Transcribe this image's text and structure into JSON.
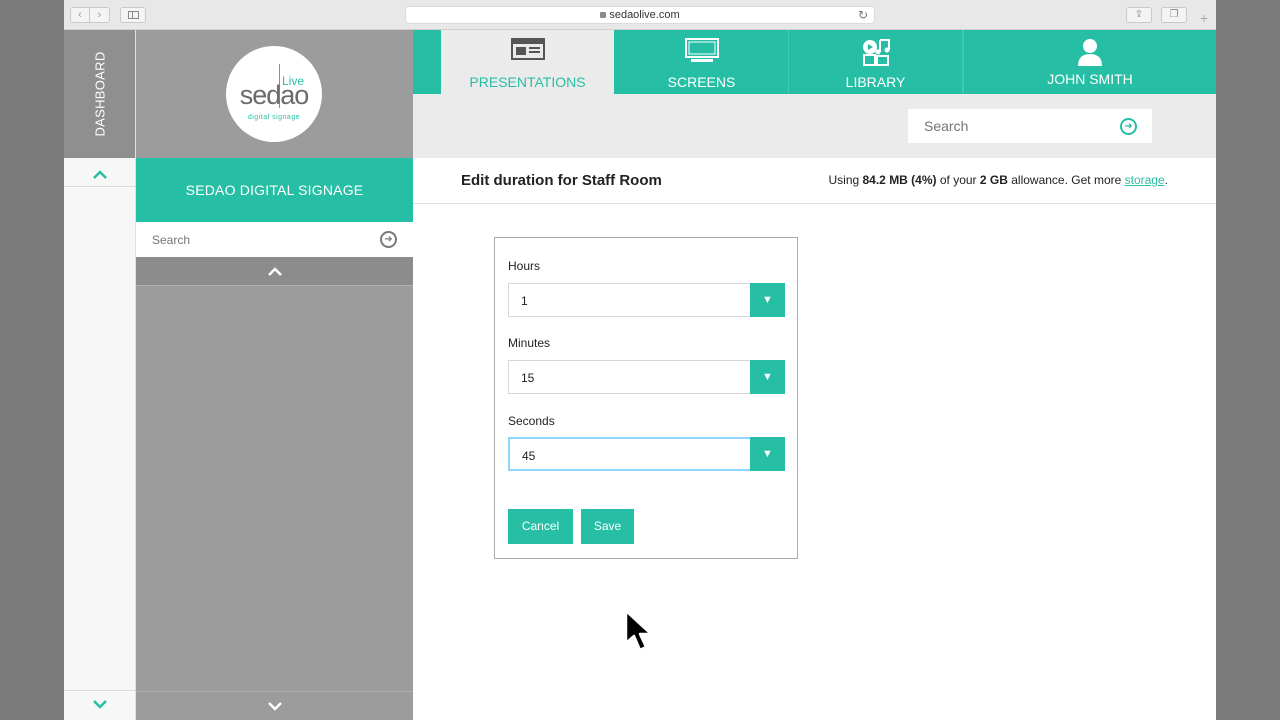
{
  "browser": {
    "url": "sedaolive.com",
    "back_icon": "chevron-left-icon",
    "forward_icon": "chevron-right-icon"
  },
  "rail": {
    "label": "DASHBOARD",
    "up_icon": "^",
    "down_icon": "v"
  },
  "sidebar": {
    "logo": {
      "brand": "sedao",
      "live": "Live",
      "tagline": "digital signage"
    },
    "org_name": "SEDAO DIGITAL SIGNAGE",
    "search_placeholder": "Search"
  },
  "nav": {
    "tabs": [
      {
        "label": "PRESENTATIONS",
        "icon": "presentation-icon",
        "active": true
      },
      {
        "label": "SCREENS",
        "icon": "monitor-icon",
        "active": false
      },
      {
        "label": "LIBRARY",
        "icon": "media-library-icon",
        "active": false
      },
      {
        "label": "JOHN SMITH",
        "icon": "user-icon",
        "active": false
      }
    ]
  },
  "toolbar": {
    "search_placeholder": "Search"
  },
  "header": {
    "title": "Edit duration for Staff Room",
    "usage_prefix": "Using ",
    "usage_used": "84.2 MB (4%)",
    "usage_mid": " of your ",
    "usage_total": "2 GB",
    "usage_suffix": " allowance. Get more ",
    "usage_link": "storage",
    "usage_end": "."
  },
  "form": {
    "hours_label": "Hours",
    "hours_value": "1",
    "minutes_label": "Minutes",
    "minutes_value": "15",
    "seconds_label": "Seconds",
    "seconds_value": "45",
    "cancel_label": "Cancel",
    "save_label": "Save"
  },
  "colors": {
    "accent": "#26bfa5",
    "sidebar_gray": "#9c9c9c",
    "focus_ring": "#8fd6ff"
  }
}
